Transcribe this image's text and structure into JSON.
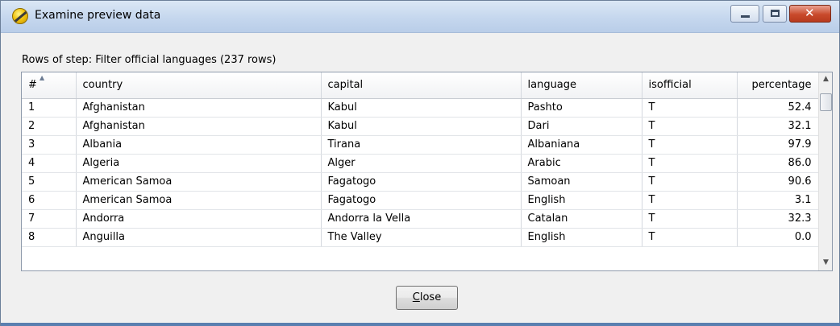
{
  "window": {
    "title": "Examine preview data",
    "controls": {
      "minimize": "minimize",
      "maximize": "maximize",
      "close": "✕"
    }
  },
  "rows_label": "Rows of step: Filter official languages (237 rows)",
  "table": {
    "columns": [
      "#",
      "country",
      "capital",
      "language",
      "isofficial",
      "percentage"
    ],
    "sort": {
      "column": "#",
      "direction": "ascending"
    },
    "rows": [
      [
        "1",
        "Afghanistan",
        "Kabul",
        "Pashto",
        "T",
        "52.4"
      ],
      [
        "2",
        "Afghanistan",
        "Kabul",
        "Dari",
        "T",
        "32.1"
      ],
      [
        "3",
        "Albania",
        "Tirana",
        "Albaniana",
        "T",
        "97.9"
      ],
      [
        "4",
        "Algeria",
        "Alger",
        "Arabic",
        "T",
        "86.0"
      ],
      [
        "5",
        "American Samoa",
        "Fagatogo",
        "Samoan",
        "T",
        "90.6"
      ],
      [
        "6",
        "American Samoa",
        "Fagatogo",
        "English",
        "T",
        "3.1"
      ],
      [
        "7",
        "Andorra",
        "Andorra la Vella",
        "Catalan",
        "T",
        "32.3"
      ],
      [
        "8",
        "Anguilla",
        "The Valley",
        "English",
        "T",
        "0.0"
      ]
    ]
  },
  "buttons": {
    "close_prefix": "",
    "close_mnemonic": "C",
    "close_rest": "lose"
  },
  "colors": {
    "titlebar": "#c5d7ee",
    "close_caption": "#c94a2c",
    "accent_edge": "#5a7fb0"
  }
}
